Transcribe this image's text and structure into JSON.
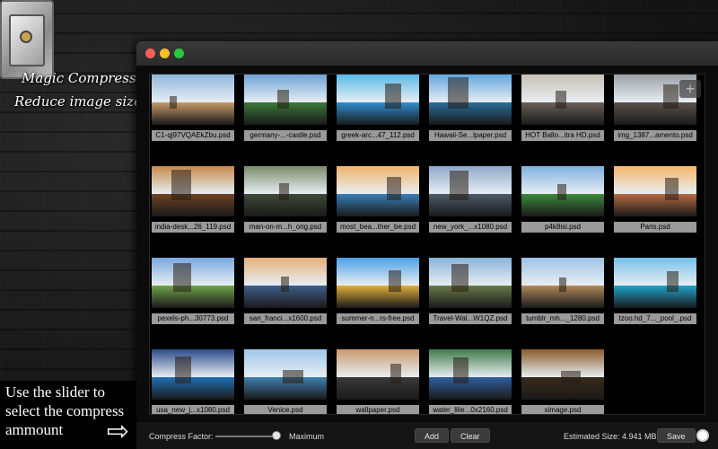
{
  "promo": {
    "title": "Magic Compress",
    "subtitle": "Reduce image size"
  },
  "hint": {
    "text": "Use the slider to\nselect the compress\nammount",
    "arrow": "⇨"
  },
  "window": {
    "add_icon": "+",
    "images": [
      "C1-qj97VQAEkZbu.psd",
      "germany-...-castle.psd",
      "greek-arc...47_112.psd",
      "Hawaii-Se...lpaper.psd",
      "HOT Ballo...itra HD.psd",
      "img_1387...amento.psd",
      "india-desk...26_119.psd",
      "man-on-m...h_orig.psd",
      "most_bea...ther_be.psd",
      "new_york_...x1080.psd",
      "p4k8isi.psd",
      "Paris.psd",
      "pexels-ph...30773.psd",
      "san_franci...x1600.psd",
      "summer-n...rs-free.psd",
      "Travel-Wal...W1QZ.psd",
      "tumblr_mh..._1280.psd",
      "tzoo.hd_7..._pool_.psd",
      "usa_new_j...x1080.psd",
      "Venice.psd",
      "wallpaper.psd",
      "water_lilie...0x2160.psd",
      "ximage.psd"
    ]
  },
  "toolbar": {
    "compress_label": "Compress Factor:",
    "compress_value": 1.0,
    "maximum_label": "Maximum",
    "add_label": "Add",
    "clear_label": "Clear",
    "estimated_label": "Estimated Size: 4.941 MB",
    "save_label": "Save"
  },
  "colors": {
    "close": "#fe5f57",
    "minimize": "#febc2e",
    "maximize": "#28c840"
  }
}
